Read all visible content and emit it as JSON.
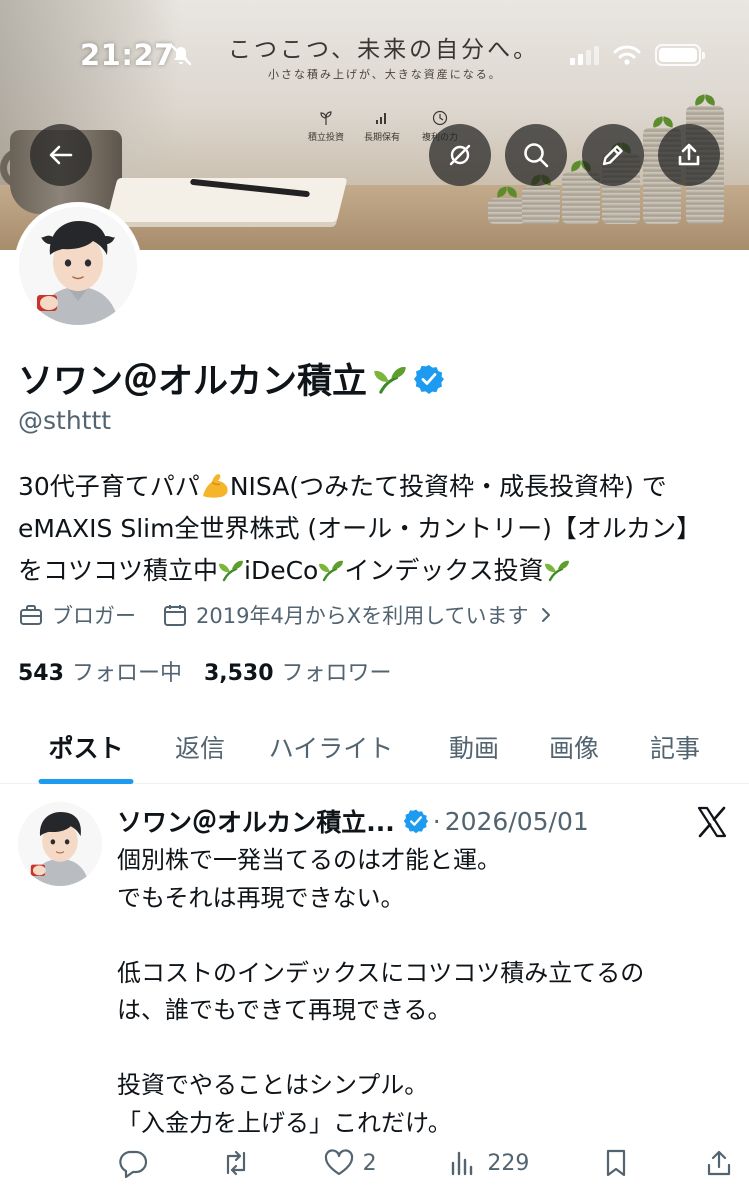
{
  "status_bar": {
    "time": "21:27"
  },
  "banner": {
    "title": "こつこつ、未来の自分へ。",
    "subtitle": "小さな積み上げが、大きな資産になる。",
    "features": [
      "積立投資",
      "長期保有",
      "複利の力"
    ]
  },
  "profile": {
    "display_name": "ソワン＠オルカン積立",
    "handle": "@sthttt",
    "bio_lines": [
      [
        "30代子育てパパ",
        "NISA(つみたて投資枠・成長投資枠) で"
      ],
      [
        "eMAXIS Slim全世界株式 (オール・カントリー)【オルカン】"
      ],
      [
        "をコツコツ積立中",
        "iDeCo",
        "インデックス投資"
      ]
    ],
    "category": "ブロガー",
    "joined": "2019年4月からXを利用しています",
    "following_count": "543",
    "following_label": "フォロー中",
    "followers_count": "3,530",
    "followers_label": "フォロワー"
  },
  "tabs": [
    "ポスト",
    "返信",
    "ハイライト",
    "動画",
    "画像",
    "記事"
  ],
  "active_tab": 0,
  "post": {
    "author": "ソワン＠オルカン積立...",
    "separator": "·",
    "date": "2026/05/01",
    "lines": [
      "個別株で一発当てるのは才能と運。",
      "でもそれは再現できない。",
      "",
      "低コストのインデックスにコツコツ積み立てるの",
      "は、誰でもできて再現できる。",
      "",
      "投資でやることはシンプル。",
      "「入金力を上げる」これだけ。"
    ],
    "likes": "2",
    "views": "229"
  },
  "colors": {
    "accent": "#1d9bf0",
    "text": "#0f1419",
    "secondary": "#536471"
  }
}
